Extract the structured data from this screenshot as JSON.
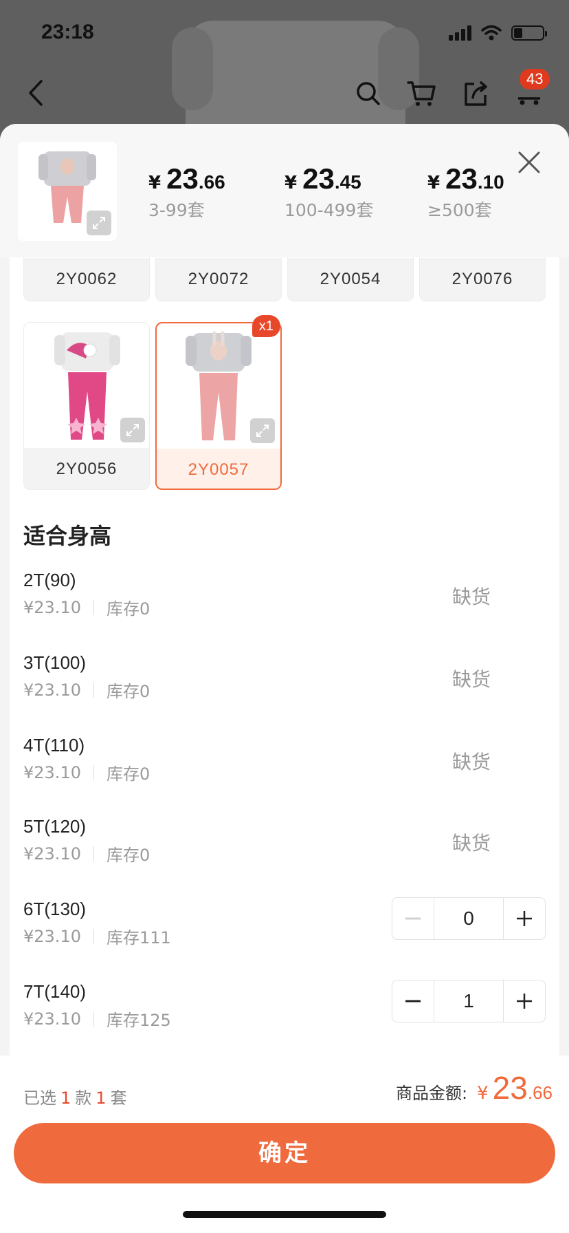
{
  "status_bar": {
    "time": "23:18"
  },
  "nav": {
    "cart_badge": "43"
  },
  "price_tiers": [
    {
      "yen": "¥",
      "int": "23",
      "dec": ".66",
      "range": "3-99套"
    },
    {
      "yen": "¥",
      "int": "23",
      "dec": ".45",
      "range": "100-499套"
    },
    {
      "yen": "¥",
      "int": "23",
      "dec": ".10",
      "range": "≥500套"
    }
  ],
  "variants_row1": [
    {
      "label": "2Y0062"
    },
    {
      "label": "2Y0072"
    },
    {
      "label": "2Y0054"
    },
    {
      "label": "2Y0076"
    }
  ],
  "variants_row2": [
    {
      "label": "2Y0056",
      "selected": false
    },
    {
      "label": "2Y0057",
      "selected": true,
      "badge": "x1"
    }
  ],
  "size_section": {
    "title": "适合身高"
  },
  "sizes": [
    {
      "name": "2T(90)",
      "price": "¥23.10",
      "stock": "库存0",
      "status": "缺货"
    },
    {
      "name": "3T(100)",
      "price": "¥23.10",
      "stock": "库存0",
      "status": "缺货"
    },
    {
      "name": "4T(110)",
      "price": "¥23.10",
      "stock": "库存0",
      "status": "缺货"
    },
    {
      "name": "5T(120)",
      "price": "¥23.10",
      "stock": "库存0",
      "status": "缺货"
    },
    {
      "name": "6T(130)",
      "price": "¥23.10",
      "stock": "库存111",
      "qty": "0"
    },
    {
      "name": "7T(140)",
      "price": "¥23.10",
      "stock": "库存125",
      "qty": "1"
    }
  ],
  "footer": {
    "selected_prefix": "已选",
    "selected_styles": "1",
    "styles_unit": "款",
    "selected_sets": "1",
    "sets_unit": "套",
    "total_label": "商品金额:",
    "total_yen": "¥",
    "total_int": "23",
    "total_dec": ".66",
    "confirm_label": "确定"
  },
  "colors": {
    "accent": "#ef6b3e",
    "badge": "#e8482a"
  }
}
